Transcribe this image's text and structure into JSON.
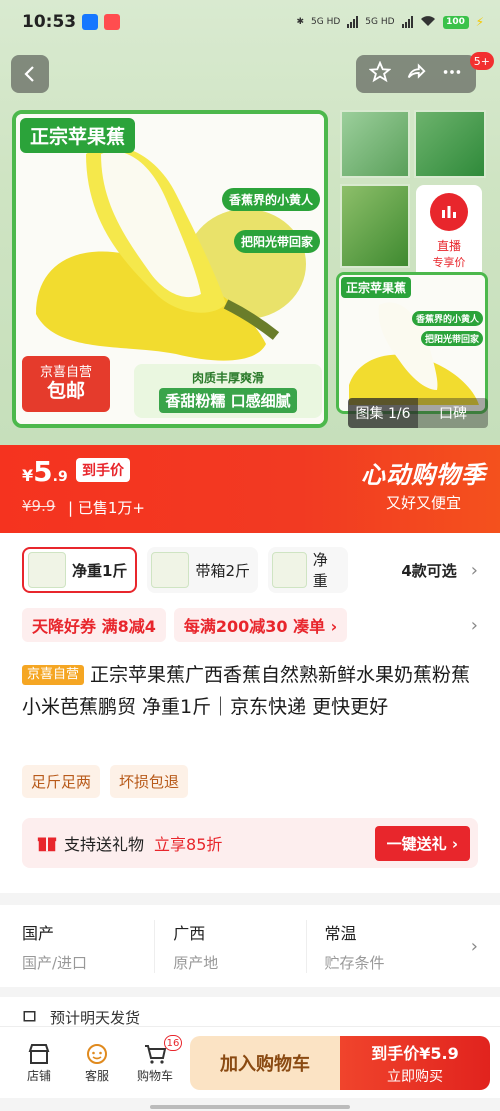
{
  "status_bar": {
    "time": "10:53",
    "signal1": "5G HD",
    "signal2": "5G HD",
    "battery": "100"
  },
  "nav": {
    "message_count": "5+"
  },
  "hero": {
    "main_title": "正宗苹果蕉",
    "bubble1": "香蕉界的小黄人",
    "bubble2": "把阳光带回家",
    "self_badge_line1": "京喜自营",
    "self_badge_line2": "包邮",
    "bottom_line1": "肉质丰厚爽滑",
    "bottom_line2": "香甜粉糯 口感细腻",
    "side_title": "正宗苹果蕉",
    "side_b1": "香蕉界的小黄人",
    "side_b2": "把阳光带回家",
    "live_label": "直播",
    "live_price": "专享价",
    "gallery_label": "图集 1/6",
    "reviews_label": "口碑"
  },
  "price": {
    "currency": "¥",
    "integer": "5",
    "decimal": ".9",
    "tag": "到手价",
    "original": "¥9.9",
    "sold": "| 已售1万+",
    "campaign_title": "心动购物季",
    "campaign_sub": "又好又便宜"
  },
  "specs": {
    "items": [
      {
        "label": "净重1斤"
      },
      {
        "label": "带箱2斤"
      },
      {
        "label": "净重"
      }
    ],
    "more": "4款可选"
  },
  "coupons": {
    "c1": "天降好券  满8减4",
    "c2": "每满200减30  凑单 ›"
  },
  "product": {
    "badge": "京喜自营",
    "title": "正宗苹果蕉广西香蕉自然熟新鲜水果奶蕉粉蕉小米芭蕉鹏贸 净重1斤｜京东快递 更快更好"
  },
  "tags": [
    "足斤足两",
    "坏损包退"
  ],
  "gift": {
    "label": "支持送礼物",
    "discount": "立享85折",
    "button": "一键送礼 ›"
  },
  "info": {
    "cols": [
      {
        "value": "国产",
        "key": "国产/进口"
      },
      {
        "value": "广西",
        "key": "原产地"
      },
      {
        "value": "常温",
        "key": "贮存条件"
      }
    ]
  },
  "peek_text": "预计明天发货",
  "bottom": {
    "store": "店铺",
    "service": "客服",
    "cart": "购物车",
    "cart_count": "16",
    "add_cart": "加入购物车",
    "buy_line1": "到手价¥5.9",
    "buy_line2": "立即购买"
  }
}
